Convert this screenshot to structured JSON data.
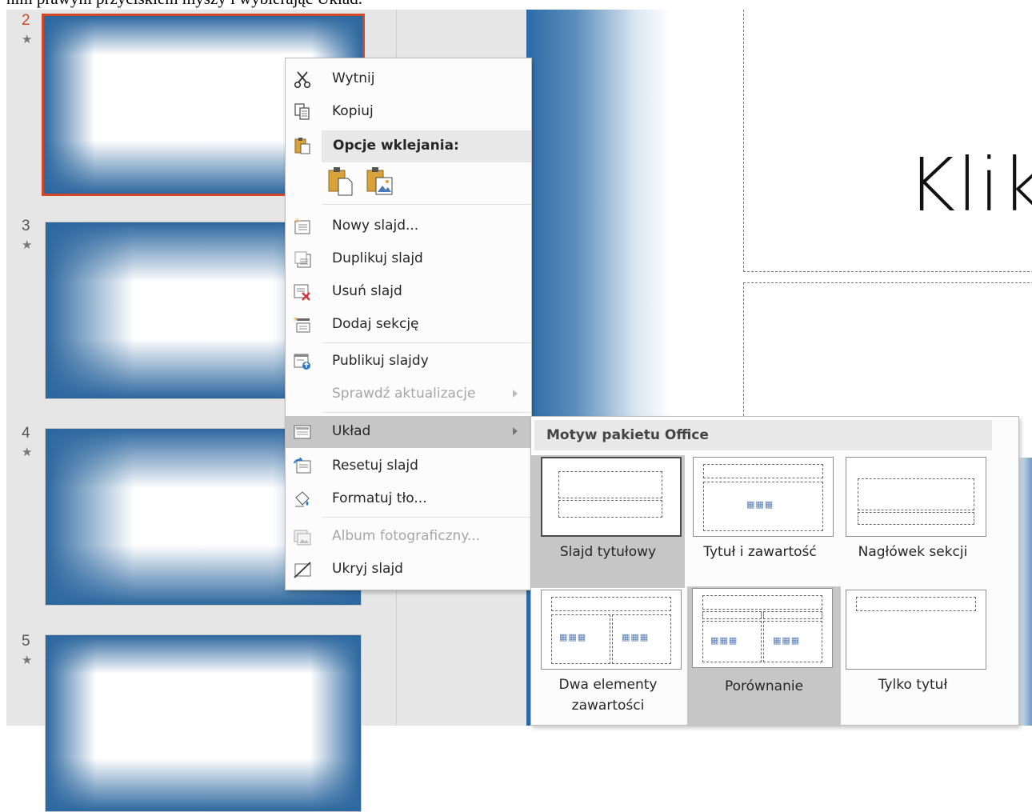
{
  "caption": "nim prawym przyciskiem myszy i wybierając Układ.",
  "thumbnails": [
    {
      "number": "2",
      "star": "★"
    },
    {
      "number": "3",
      "star": "★"
    },
    {
      "number": "4",
      "star": "★"
    },
    {
      "number": "5",
      "star": "★"
    }
  ],
  "main_slide": {
    "title_text": "Klik"
  },
  "context_menu": {
    "items": [
      {
        "label": "Wytnij",
        "icon": "scissors-icon"
      },
      {
        "label": "Kopiuj",
        "icon": "copy-icon"
      },
      {
        "label": "Opcje wklejania:",
        "icon": "clipboard-icon"
      },
      {
        "label": "Nowy slajd...",
        "icon": "new-slide-icon"
      },
      {
        "label": "Duplikuj slajd",
        "icon": "duplicate-slide-icon"
      },
      {
        "label": "Usuń slajd",
        "icon": "delete-slide-icon"
      },
      {
        "label": "Dodaj sekcję",
        "icon": "add-section-icon"
      },
      {
        "label": "Publikuj slajdy",
        "icon": "publish-slides-icon"
      },
      {
        "label": "Sprawdź aktualizacje",
        "icon": "",
        "disabled": true
      },
      {
        "label": "Układ",
        "icon": "layout-icon",
        "highlighted": true
      },
      {
        "label": "Resetuj slajd",
        "icon": "reset-slide-icon"
      },
      {
        "label": "Formatuj tło...",
        "icon": "format-background-icon"
      },
      {
        "label": "Album fotograficzny...",
        "icon": "photo-album-icon",
        "disabled": true
      },
      {
        "label": "Ukryj slajd",
        "icon": "hide-slide-icon"
      }
    ],
    "paste_options": [
      "paste-keep-source-icon",
      "paste-picture-icon"
    ]
  },
  "layout_submenu": {
    "header": "Motyw pakietu Office",
    "layouts": [
      {
        "name": "Slajd tytułowy",
        "selected": true,
        "highlighted": true
      },
      {
        "name": "Tytuł i zawartość"
      },
      {
        "name": "Nagłówek sekcji"
      },
      {
        "name": "Dwa elementy zawartości"
      },
      {
        "name": "Porównanie",
        "highlighted": true
      },
      {
        "name": "Tylko tytuł"
      }
    ]
  },
  "colors": {
    "selection_accent": "#d24726",
    "slide_blue": "#2c679f",
    "menu_highlight": "#c6c6c6"
  }
}
